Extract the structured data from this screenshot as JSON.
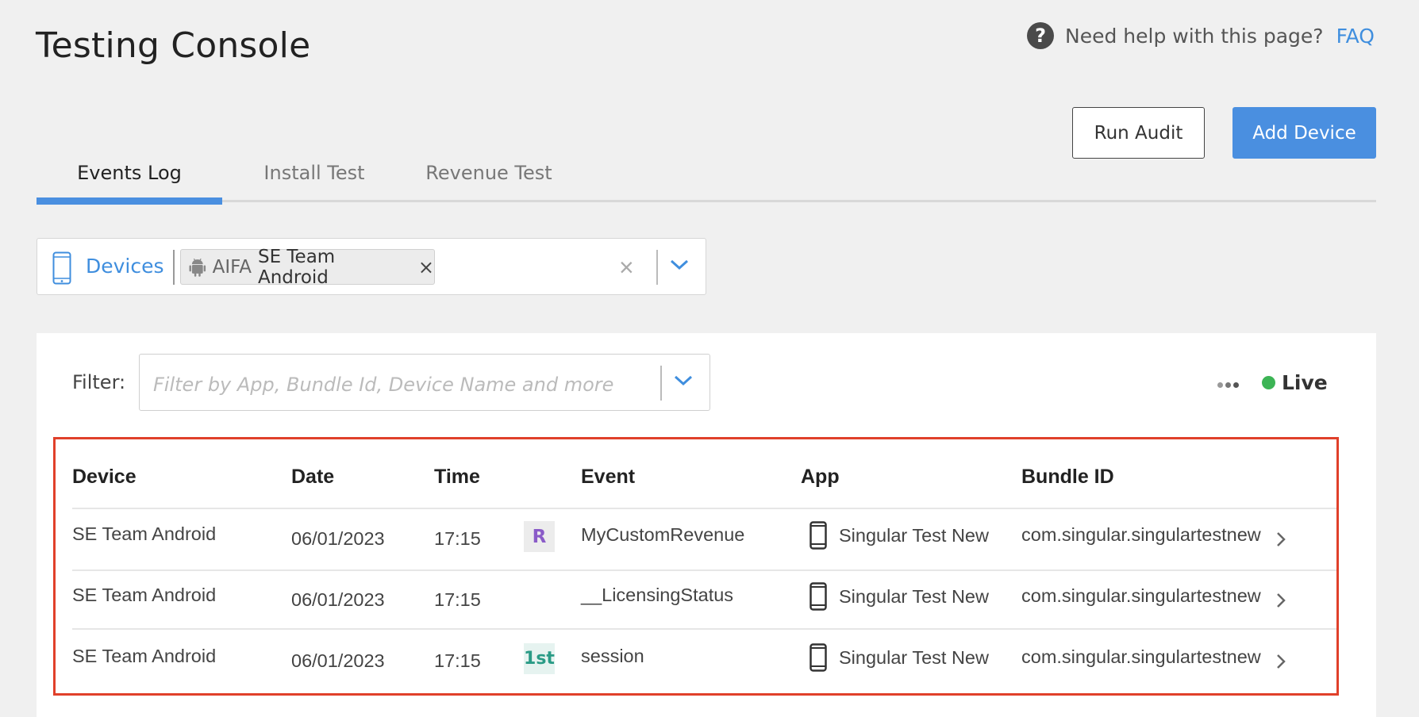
{
  "header": {
    "title": "Testing Console",
    "help_text": "Need help with this page?",
    "faq_label": "FAQ"
  },
  "actions": {
    "run_audit": "Run Audit",
    "add_device": "Add Device"
  },
  "tabs": [
    {
      "label": "Events Log",
      "active": true
    },
    {
      "label": "Install Test",
      "active": false
    },
    {
      "label": "Revenue Test",
      "active": false
    }
  ],
  "device_selector": {
    "label": "Devices",
    "selected": {
      "id_type": "AIFA",
      "name": "SE Team Android",
      "platform_icon": "android-icon"
    }
  },
  "filter": {
    "label": "Filter:",
    "placeholder": "Filter by App, Bundle Id, Device Name and more"
  },
  "live_status": {
    "label": "Live",
    "color": "#3cb455"
  },
  "colors": {
    "accent": "#4a8fe0",
    "highlight_border": "#e0402a"
  },
  "table": {
    "columns": [
      "Device",
      "Date",
      "Time",
      "",
      "Event",
      "App",
      "Bundle ID"
    ],
    "rows": [
      {
        "device": "SE Team Android",
        "date": "06/01/2023",
        "time": "17:15",
        "badge": "R",
        "event": "MyCustomRevenue",
        "app": "Singular Test New",
        "bundle_id": "com.singular.singulartestnew"
      },
      {
        "device": "SE Team Android",
        "date": "06/01/2023",
        "time": "17:15",
        "badge": "",
        "event": "__LicensingStatus",
        "app": "Singular Test New",
        "bundle_id": "com.singular.singulartestnew"
      },
      {
        "device": "SE Team Android",
        "date": "06/01/2023",
        "time": "17:15",
        "badge": "1st",
        "event": "session",
        "app": "Singular Test New",
        "bundle_id": "com.singular.singulartestnew"
      }
    ]
  }
}
